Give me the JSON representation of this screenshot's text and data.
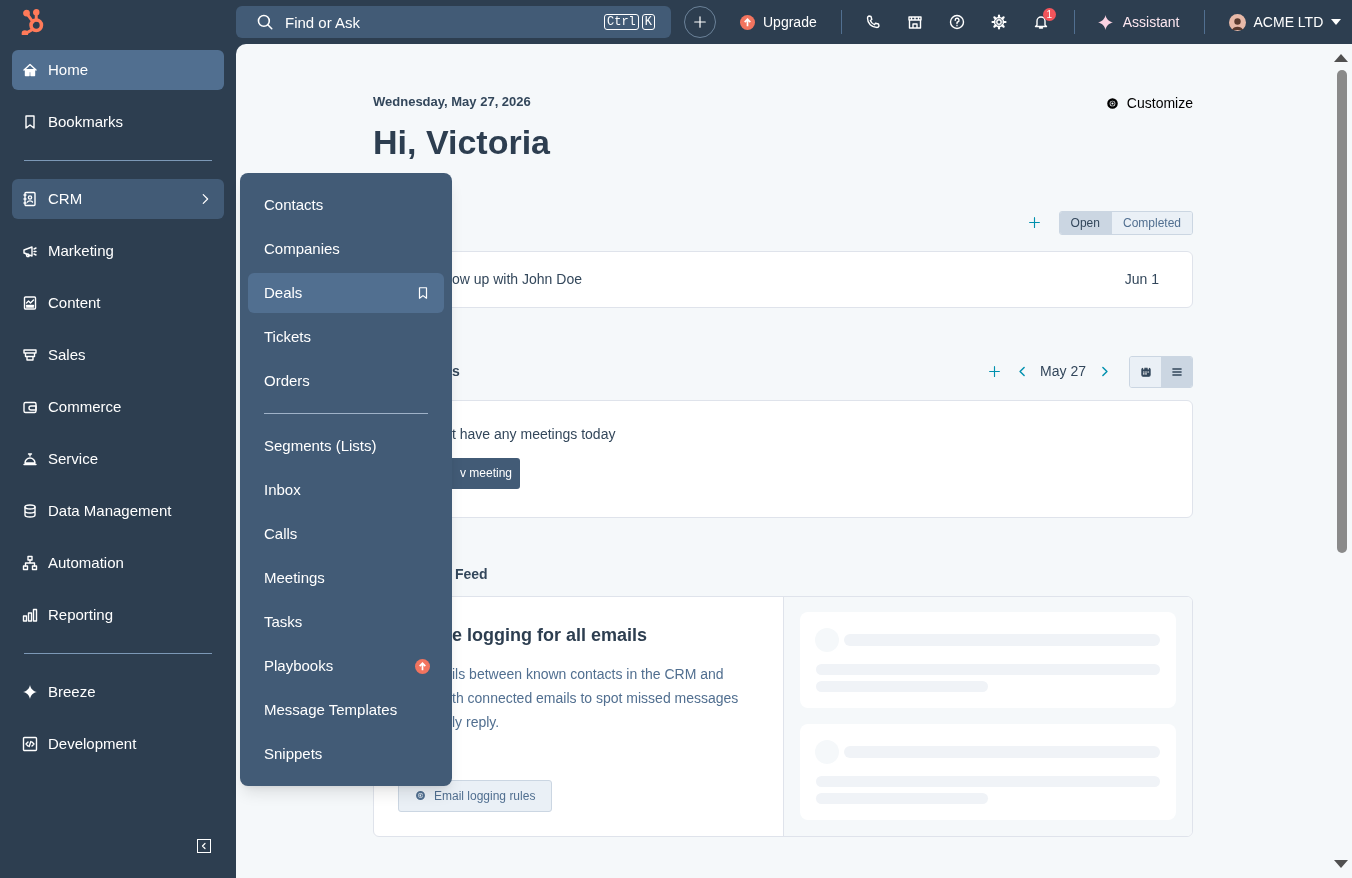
{
  "topbar": {
    "search": {
      "placeholder": "Find or Ask",
      "shortcut": [
        "Ctrl",
        "K"
      ]
    },
    "upgrade": "Upgrade",
    "notifications_badge": "1",
    "assistant": "Assistant",
    "account": "ACME LTD"
  },
  "sidebar": {
    "groups": [
      [
        {
          "label": "Home",
          "selected": true,
          "expanded": false
        },
        {
          "label": "Bookmarks",
          "selected": false,
          "expanded": false
        }
      ],
      [
        {
          "label": "CRM",
          "selected": false,
          "expanded": true
        },
        {
          "label": "Marketing",
          "selected": false,
          "expanded": false
        },
        {
          "label": "Content",
          "selected": false,
          "expanded": false
        },
        {
          "label": "Sales",
          "selected": false,
          "expanded": false
        },
        {
          "label": "Commerce",
          "selected": false,
          "expanded": false
        },
        {
          "label": "Service",
          "selected": false,
          "expanded": false
        },
        {
          "label": "Data Management",
          "selected": false,
          "expanded": false
        },
        {
          "label": "Automation",
          "selected": false,
          "expanded": false
        },
        {
          "label": "Reporting",
          "selected": false,
          "expanded": false
        }
      ],
      [
        {
          "label": "Breeze",
          "selected": false,
          "expanded": false
        },
        {
          "label": "Development",
          "selected": false,
          "expanded": false
        }
      ]
    ]
  },
  "crm_menu": {
    "groups": [
      [
        {
          "label": "Contacts",
          "selected": false,
          "upgrade": false
        },
        {
          "label": "Companies",
          "selected": false,
          "upgrade": false
        },
        {
          "label": "Deals",
          "selected": true,
          "upgrade": false
        },
        {
          "label": "Tickets",
          "selected": false,
          "upgrade": false
        },
        {
          "label": "Orders",
          "selected": false,
          "upgrade": false
        }
      ],
      [
        {
          "label": "Segments (Lists)",
          "selected": false,
          "upgrade": false
        },
        {
          "label": "Inbox",
          "selected": false,
          "upgrade": false
        },
        {
          "label": "Calls",
          "selected": false,
          "upgrade": false
        },
        {
          "label": "Meetings",
          "selected": false,
          "upgrade": false
        },
        {
          "label": "Tasks",
          "selected": false,
          "upgrade": false
        },
        {
          "label": "Playbooks",
          "selected": false,
          "upgrade": true
        },
        {
          "label": "Message Templates",
          "selected": false,
          "upgrade": false
        },
        {
          "label": "Snippets",
          "selected": false,
          "upgrade": false
        }
      ]
    ]
  },
  "header": {
    "date": "Wednesday, May 27, 2026",
    "greeting": "Hi, Victoria",
    "customize": "Customize"
  },
  "tasks": {
    "filters": [
      {
        "label": "Open",
        "selected": true
      },
      {
        "label": "Completed",
        "selected": false
      }
    ],
    "rows": [
      {
        "title": "ow up with John Doe",
        "due": "Jun 1"
      }
    ]
  },
  "meetings": {
    "title": "s",
    "date": "May 27",
    "views": [
      {
        "kind": "calendar",
        "selected": false
      },
      {
        "kind": "list",
        "selected": true
      }
    ],
    "empty_text": "t have any meetings today",
    "button": "v meeting"
  },
  "feed": {
    "title": "Feed",
    "card": {
      "title": "e logging for all emails",
      "lines": [
        "ils between known contacts in the CRM and",
        "th connected emails to spot missed messages",
        "ly reply."
      ],
      "button": "Email logging rules"
    }
  }
}
